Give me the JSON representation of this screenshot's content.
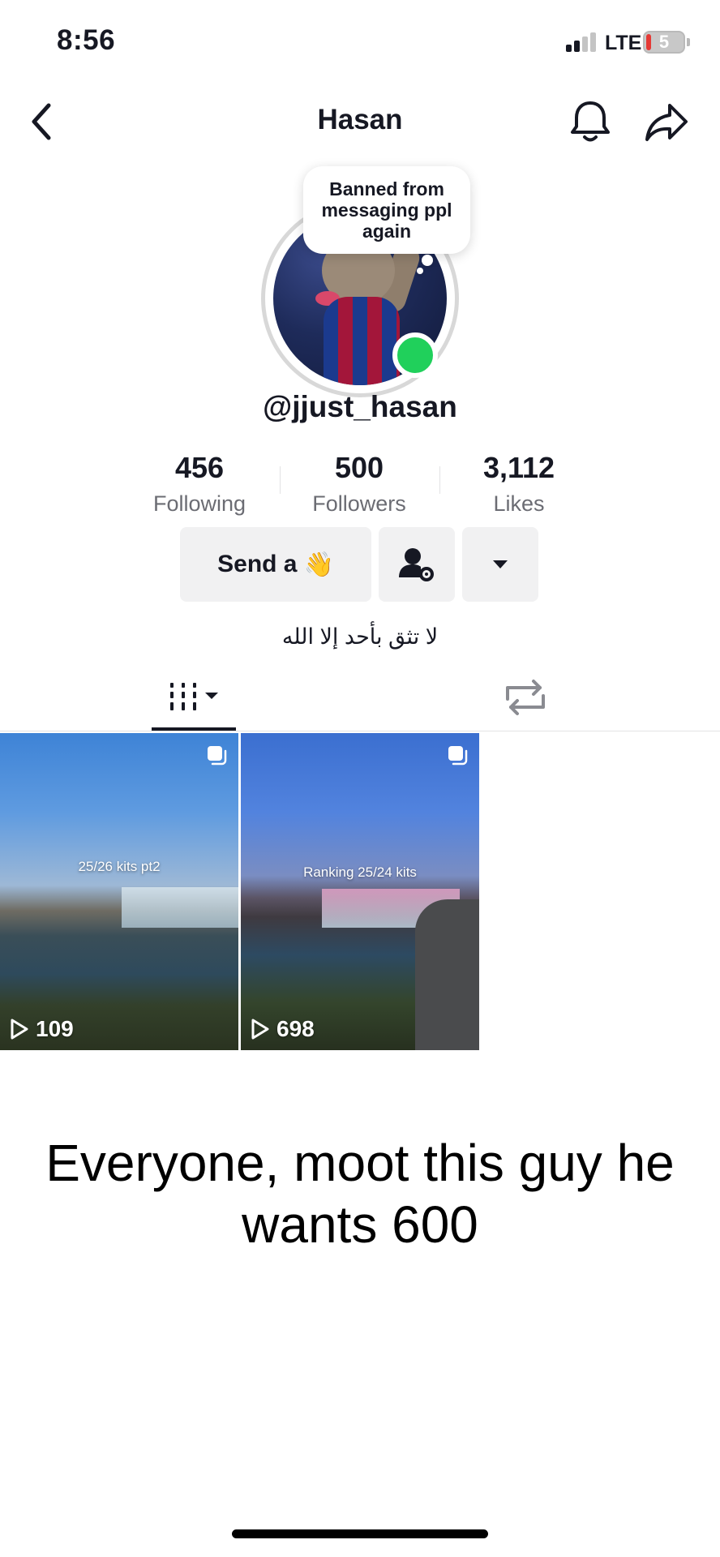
{
  "status_bar": {
    "time": "8:56",
    "network": "LTE",
    "battery_level": "5",
    "battery_color": "#e53935"
  },
  "nav": {
    "title": "Hasan",
    "back_icon": "chevron-left-icon",
    "bell_icon": "bell-icon",
    "share_icon": "share-arrow-icon"
  },
  "profile": {
    "note_bubble": "Banned from messaging ppl again",
    "username": "@jjust_hasan",
    "online_color": "#20d05b",
    "stats": [
      {
        "value": "456",
        "label": "Following"
      },
      {
        "value": "500",
        "label": "Followers"
      },
      {
        "value": "3,112",
        "label": "Likes"
      }
    ],
    "send_button": "Send a",
    "send_emoji": "👋",
    "bio": "لا تثق بأحد إلا الله"
  },
  "tabs": {
    "videos_icon": "grid-bars-icon",
    "repost_icon": "repost-icon"
  },
  "videos": [
    {
      "caption": "25/26 kits pt2",
      "plays": "109"
    },
    {
      "caption": "Ranking 25/24 kits",
      "plays": "698"
    }
  ],
  "overlay_caption": "Everyone, moot this guy he wants 600"
}
